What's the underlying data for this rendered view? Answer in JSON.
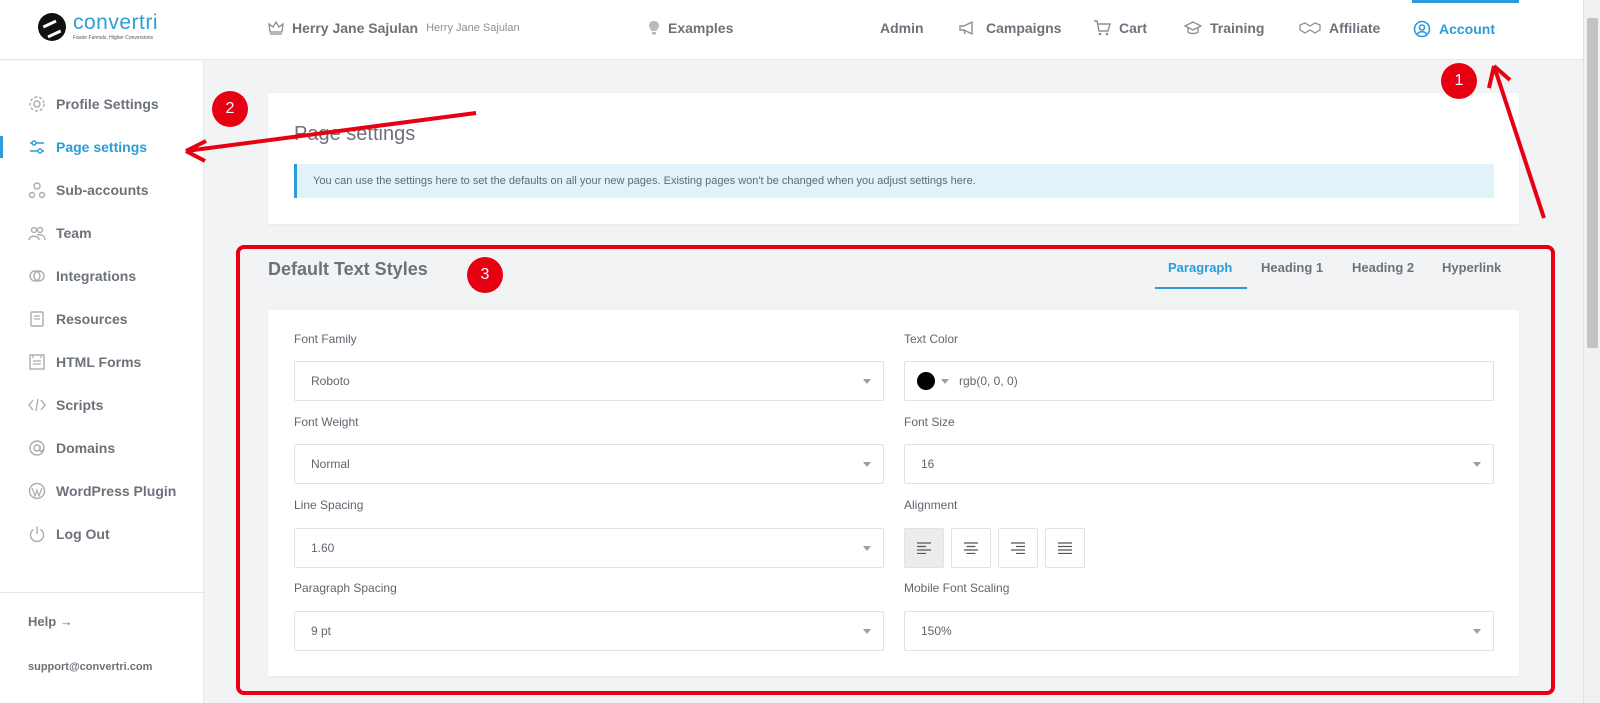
{
  "brand": {
    "name": "convertri",
    "tagline": "Faster Funnels, Higher Conversions"
  },
  "header": {
    "user_name": "Herry Jane Sajulan",
    "user_sub": "Herry Jane Sajulan",
    "examples": "Examples",
    "nav": [
      {
        "label": "Admin",
        "icon": ""
      },
      {
        "label": "Campaigns",
        "icon": "megaphone-icon"
      },
      {
        "label": "Cart",
        "icon": "cart-icon"
      },
      {
        "label": "Training",
        "icon": "graduation-cap-icon"
      },
      {
        "label": "Affiliate",
        "icon": "handshake-icon"
      },
      {
        "label": "Account",
        "icon": "user-circle-icon",
        "active": true
      }
    ]
  },
  "sidebar": {
    "items": [
      {
        "label": "Profile Settings",
        "icon": "gear-icon"
      },
      {
        "label": "Page settings",
        "icon": "sliders-icon",
        "active": true
      },
      {
        "label": "Sub-accounts",
        "icon": "sub-accounts-icon"
      },
      {
        "label": "Team",
        "icon": "team-icon"
      },
      {
        "label": "Integrations",
        "icon": "link-icon"
      },
      {
        "label": "Resources",
        "icon": "book-icon"
      },
      {
        "label": "HTML Forms",
        "icon": "form-icon"
      },
      {
        "label": "Scripts",
        "icon": "code-icon"
      },
      {
        "label": "Domains",
        "icon": "at-icon"
      },
      {
        "label": "WordPress Plugin",
        "icon": "wordpress-icon"
      },
      {
        "label": "Log Out",
        "icon": "power-icon"
      }
    ],
    "help": "Help →",
    "support": "support@convertri.com"
  },
  "main": {
    "page_title": "Page settings",
    "info": "You can use the settings here to set the defaults on all your new pages. Existing pages won't be changed when you adjust settings here.",
    "section_title": "Default Text Styles",
    "tabs": [
      "Paragraph",
      "Heading 1",
      "Heading 2",
      "Hyperlink"
    ],
    "active_tab": "Paragraph",
    "form": {
      "font_family": {
        "label": "Font Family",
        "value": "Roboto"
      },
      "text_color": {
        "label": "Text Color",
        "value": "rgb(0, 0, 0)",
        "swatch": "#000000"
      },
      "font_weight": {
        "label": "Font Weight",
        "value": "Normal"
      },
      "font_size": {
        "label": "Font Size",
        "value": "16"
      },
      "line_spacing": {
        "label": "Line Spacing",
        "value": "1.60"
      },
      "alignment": {
        "label": "Alignment",
        "options": [
          "left",
          "center",
          "right",
          "justify"
        ],
        "selected": "left"
      },
      "paragraph_spacing": {
        "label": "Paragraph Spacing",
        "value": "9 pt"
      },
      "mobile_font_scaling": {
        "label": "Mobile Font Scaling",
        "value": "150%"
      }
    }
  },
  "annotations": {
    "badges": [
      "1",
      "2",
      "3"
    ],
    "color": "#e60012"
  },
  "colors": {
    "accent": "#2a9dd8",
    "annotation": "#e60012"
  }
}
